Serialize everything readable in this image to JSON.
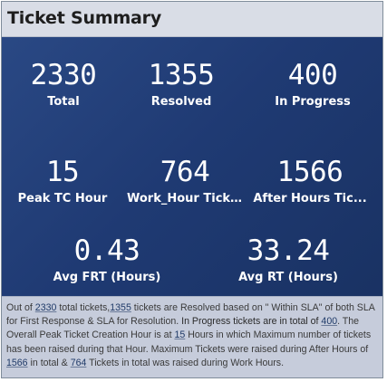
{
  "header": {
    "title": "Ticket Summary"
  },
  "metrics": {
    "total": {
      "value": "2330",
      "label": "Total"
    },
    "resolved": {
      "value": "1355",
      "label": "Resolved"
    },
    "in_progress": {
      "value": "400",
      "label": "In Progress"
    },
    "peak_tc_hour": {
      "value": "15",
      "label": "Peak TC Hour"
    },
    "work_hour_tickets": {
      "value": "764",
      "label": "Work_Hour Tick..."
    },
    "after_hours_tickets": {
      "value": "1566",
      "label": "After Hours Tic..."
    },
    "avg_frt": {
      "value": "0.43",
      "label": "Avg FRT (Hours)"
    },
    "avg_rt": {
      "value": "33.24",
      "label": "Avg RT (Hours)"
    }
  },
  "summary": {
    "s1": "Out of ",
    "v_total": "2330",
    "s2": " total tickets,",
    "v_resolved": "1355",
    "s3": " tickets are Resolved based on \" Within SLA\" of both SLA for First Response & SLA for Resolution. ",
    "s4": "In Progress tickets are in total of ",
    "v_progress": "400",
    "s5": ". The Overall Peak Ticket Creation Hour is at ",
    "v_peak": "15",
    "s6": " Hours in which Maximum number of tickets has been raised during that Hour. Maximum Tickets were raised during After Hours of ",
    "v_after": "1566",
    "s7": " in total & ",
    "v_work": "764",
    "s8": " Tickets in total was raised during Work Hours."
  }
}
